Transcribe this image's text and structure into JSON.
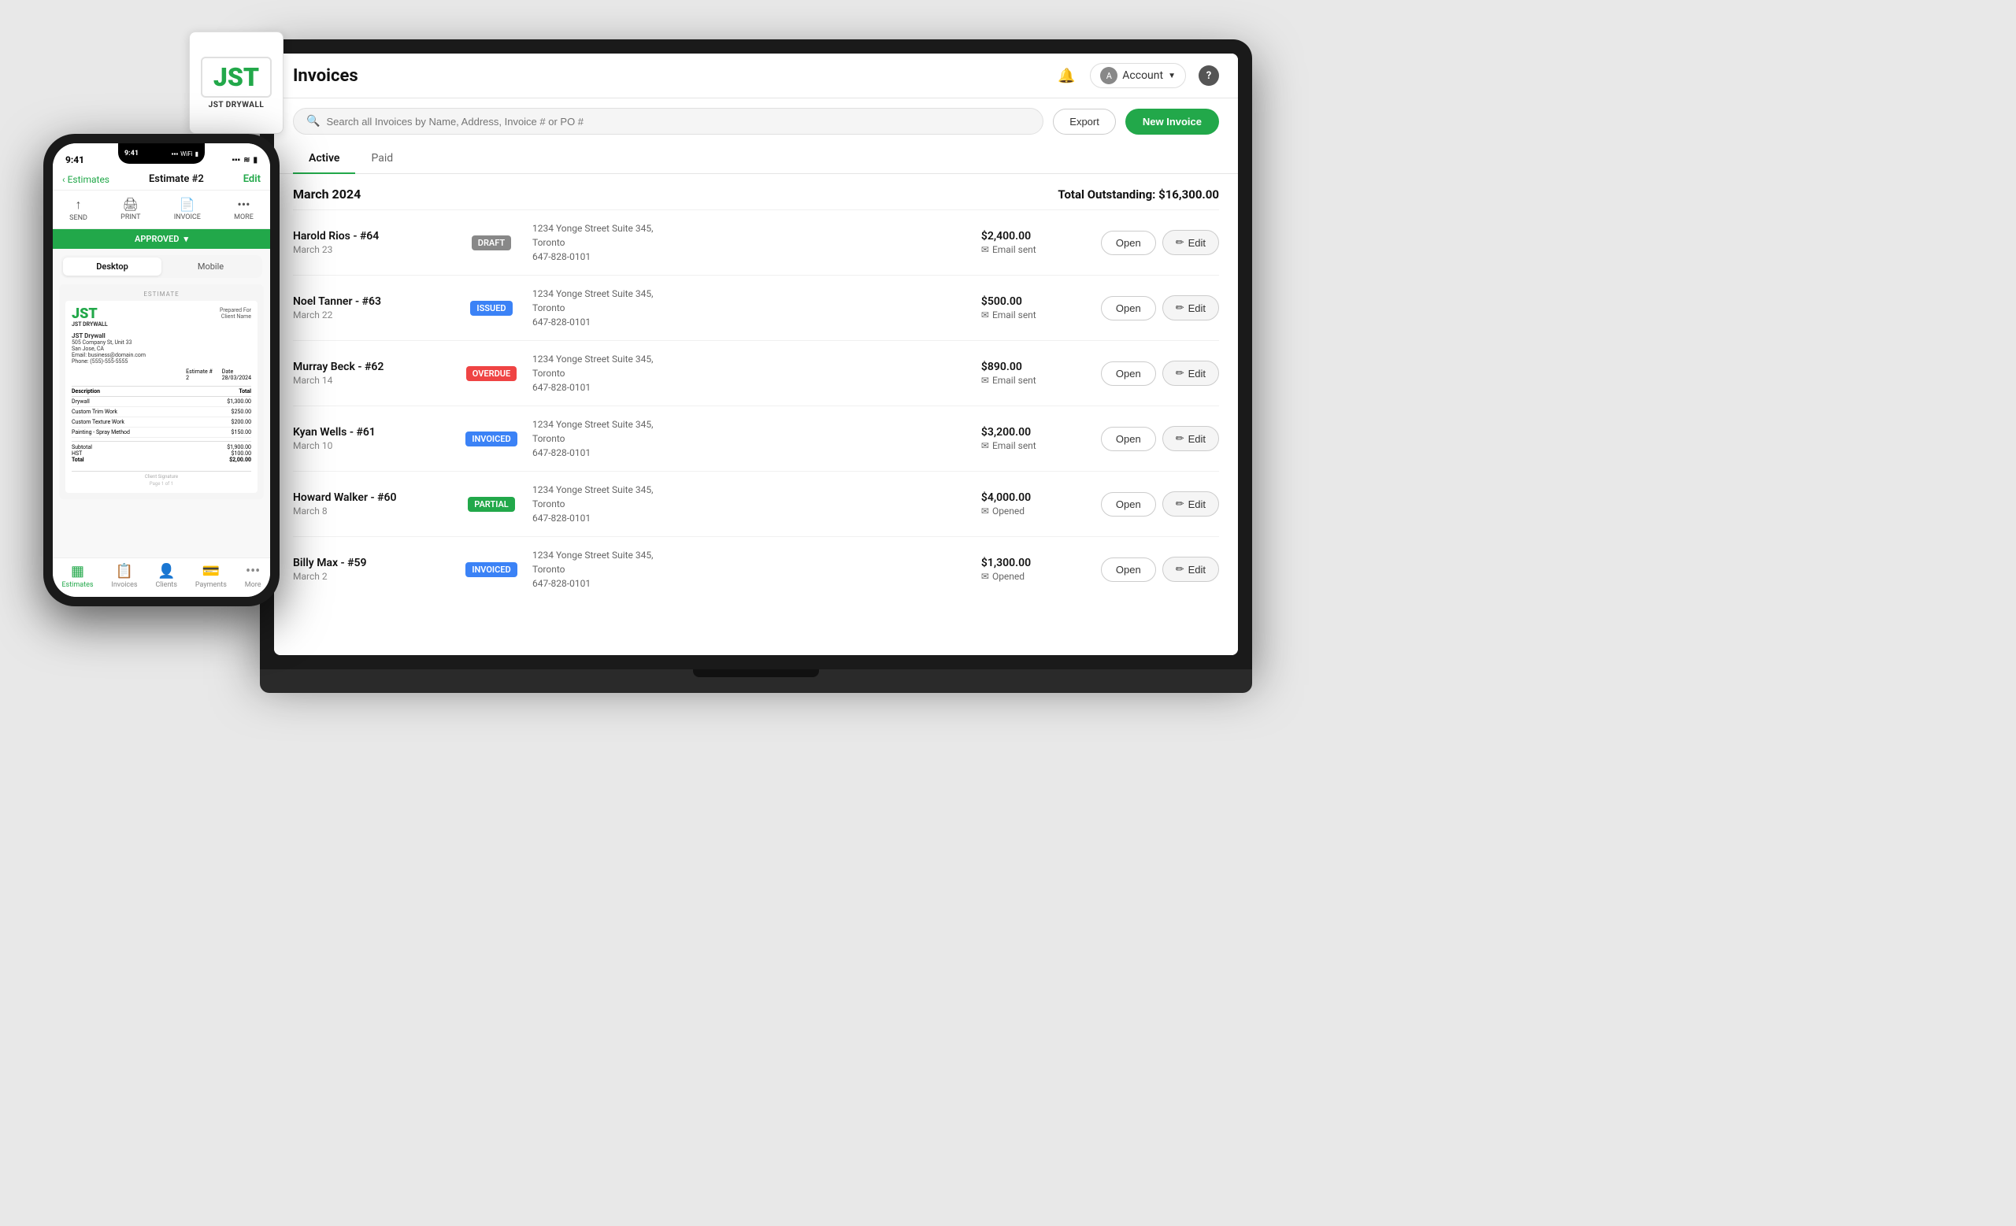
{
  "app": {
    "title": "Invoices",
    "header": {
      "title": "Invoices",
      "account_label": "Account",
      "help_label": "?"
    },
    "search": {
      "placeholder": "Search all Invoices by Name, Address, Invoice # or PO #"
    },
    "toolbar": {
      "export_label": "Export",
      "new_invoice_label": "New Invoice"
    },
    "tabs": [
      {
        "label": "Active",
        "active": true
      },
      {
        "label": "Paid",
        "active": false
      }
    ],
    "month_section": {
      "title": "March 2024",
      "total_outstanding": "Total Outstanding: $16,300.00"
    },
    "invoices": [
      {
        "name": "Harold Rios - #64",
        "date": "March 23",
        "badge": "DRAFT",
        "badge_type": "draft",
        "address_line1": "1234 Yonge Street Suite 345,",
        "address_line2": "Toronto",
        "address_line3": "647-828-0101",
        "amount": "$2,400.00",
        "status": "Email sent",
        "status_icon": "email"
      },
      {
        "name": "Noel Tanner - #63",
        "date": "March 22",
        "badge": "ISSUED",
        "badge_type": "issued",
        "address_line1": "1234 Yonge Street Suite 345,",
        "address_line2": "Toronto",
        "address_line3": "647-828-0101",
        "amount": "$500.00",
        "status": "Email sent",
        "status_icon": "email"
      },
      {
        "name": "Murray Beck - #62",
        "date": "March 14",
        "badge": "OVERDUE",
        "badge_type": "overdue",
        "address_line1": "1234 Yonge Street Suite 345,",
        "address_line2": "Toronto",
        "address_line3": "647-828-0101",
        "amount": "$890.00",
        "status": "Email sent",
        "status_icon": "email"
      },
      {
        "name": "Kyan Wells - #61",
        "date": "March 10",
        "badge": "INVOICED",
        "badge_type": "invoiced",
        "address_line1": "1234 Yonge Street Suite 345,",
        "address_line2": "Toronto",
        "address_line3": "647-828-0101",
        "amount": "$3,200.00",
        "status": "Email sent",
        "status_icon": "email"
      },
      {
        "name": "Howard Walker - #60",
        "date": "March 8",
        "badge": "PARTIAL",
        "badge_type": "partial",
        "address_line1": "1234 Yonge Street Suite 345,",
        "address_line2": "Toronto",
        "address_line3": "647-828-0101",
        "amount": "$4,000.00",
        "status": "Opened",
        "status_icon": "mail"
      },
      {
        "name": "Billy Max - #59",
        "date": "March 2",
        "badge": "INVOICED",
        "badge_type": "invoiced",
        "address_line1": "1234 Yonge Street Suite 345,",
        "address_line2": "Toronto",
        "address_line3": "647-828-0101",
        "amount": "$1,300.00",
        "status": "Opened",
        "status_icon": "mail"
      }
    ],
    "row_actions": {
      "open_label": "Open",
      "edit_label": "Edit"
    }
  },
  "laptop_logo": {
    "text": "JST",
    "subtitle": "JST DRYWALL"
  },
  "phone": {
    "time": "9:41",
    "back_label": "Estimates",
    "nav_title": "Estimate #2",
    "edit_label": "Edit",
    "tools": [
      "SEND",
      "PRINT",
      "INVOICE",
      "MORE"
    ],
    "status": "APPROVED",
    "view_toggle": [
      "Desktop",
      "Mobile"
    ],
    "estimate_section": "ESTIMATE",
    "logo_text": "JST",
    "logo_sub": "JST DRYWALL",
    "prepared_for": "Prepared For\nClient Name",
    "company_name": "JST Drywall",
    "company_address": "505 Company St, Unit 33\nSan Jose, CA",
    "company_email": "Email: business@domain.com",
    "company_phone": "Phone: (555)-555-5555",
    "estimate_number_label": "Estimate #",
    "estimate_number": "2",
    "date_label": "Date",
    "date_value": "28/03/2024",
    "line_items": [
      {
        "desc": "Drywall",
        "total": "$1,300.00"
      },
      {
        "desc": "Custom Trim Work",
        "total": "$250.00"
      },
      {
        "desc": "Custom Texture Work",
        "total": "$200.00"
      },
      {
        "desc": "Painting - Spray Method",
        "total": "$150.00"
      }
    ],
    "subtotal_label": "Subtotal",
    "subtotal": "$1,900.00",
    "hst_label": "HST",
    "hst": "$100.00",
    "total_label": "Total",
    "total": "$2,00.00",
    "signature_label": "Client Signature",
    "page_info": "Page 1 of 1",
    "bottom_nav": [
      {
        "label": "Estimates",
        "active": true
      },
      {
        "label": "Invoices",
        "active": false
      },
      {
        "label": "Clients",
        "active": false
      },
      {
        "label": "Payments",
        "active": false
      },
      {
        "label": "More",
        "active": false
      }
    ]
  }
}
